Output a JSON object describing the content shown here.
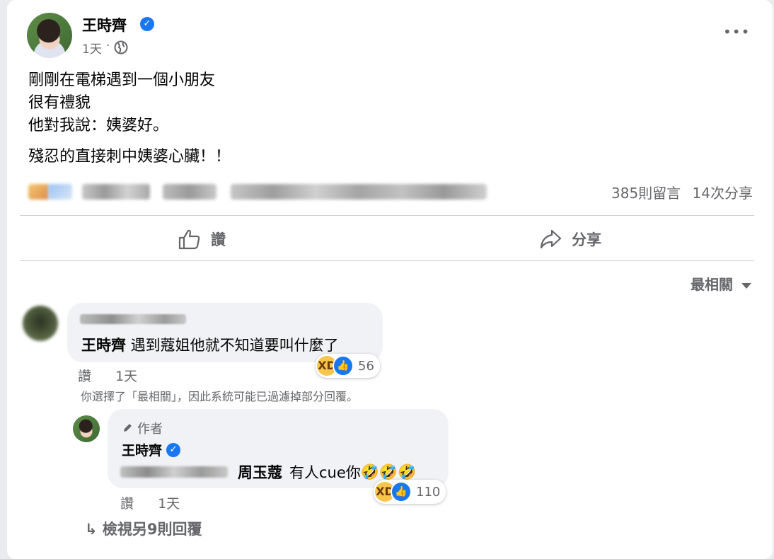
{
  "post": {
    "author": "王時齊",
    "time": "1天",
    "separator": "·",
    "body": [
      "剛剛在電梯遇到一個小朋友",
      "很有禮貌",
      "他對我說：姨婆好。"
    ],
    "body2": "殘忍的直接刺中姨婆心臟！！",
    "comment_count": "385則留言",
    "share_count": "14次分享"
  },
  "actions": {
    "like": "讚",
    "share": "分享"
  },
  "sort": {
    "label": "最相關"
  },
  "comment1": {
    "mention": "王時齊",
    "text": "遇到蔻姐他就不知道要叫什麼了",
    "reaction_count": "56",
    "like_label": "讚",
    "time": "1天"
  },
  "filter_note": "你選擇了「最相關」，因此系統可能已過濾掉部分回覆。",
  "reply1": {
    "badge": "作者",
    "author": "王時齊",
    "mention": "周玉蔻",
    "text": "有人cue你",
    "trailing_emoji": "🤣🤣🤣",
    "reaction_count": "110",
    "like_label": "讚",
    "time": "1天"
  },
  "view_more": "檢視另9則回覆",
  "icons": [
    "verified-icon",
    "globe-icon",
    "more-icon",
    "like-icon",
    "share-icon",
    "caret-down-icon",
    "pencil-icon",
    "reply-arrow-icon",
    "haha-icon"
  ],
  "colors": {
    "accent": "#1877f2",
    "muted": "#65676b",
    "bubble": "#f0f2f5"
  }
}
